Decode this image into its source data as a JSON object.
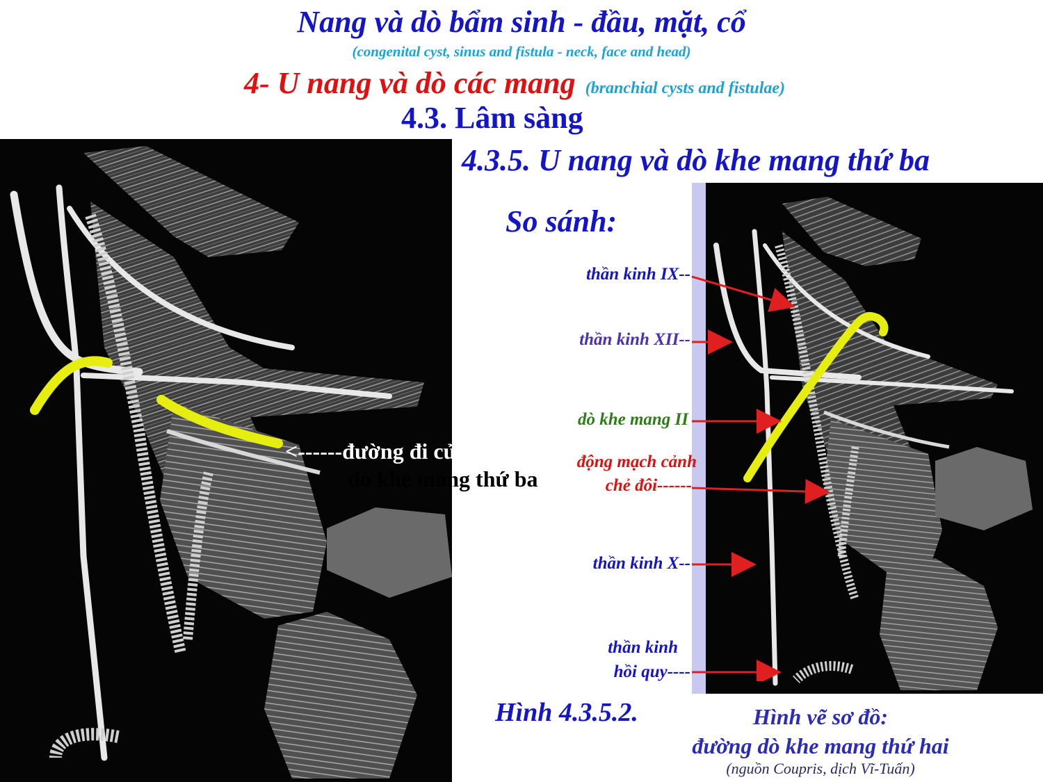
{
  "header": {
    "title": "Nang và dò bẩm sinh - đầu, mặt, cổ",
    "subtitle": "(congenital cyst, sinus and fistula - neck, face and head)",
    "section": "4- U nang và dò các mang",
    "section_en": "(branchial cysts and fistulae)",
    "subsection": "4.3. Lâm sàng",
    "subsubsection": "4.3.5. U nang và dò khe mang thứ ba"
  },
  "compare_label": "So sánh:",
  "left_figure": {
    "path_label_line1": "<------đường đi của",
    "path_label_line2": "dò khe mang thứ ba"
  },
  "labels": [
    {
      "text": "thần kinh IX--",
      "color": "#1414c8"
    },
    {
      "text": "thần kinh XII--",
      "color": "#4b2fb8"
    },
    {
      "text": "dò khe mang II",
      "color": "#2e7d1a"
    },
    {
      "text": "động mạch cảnh",
      "color": "#e01010"
    },
    {
      "text": "chẻ đôi------",
      "color": "#e01010"
    },
    {
      "text": "thần kinh X--",
      "color": "#1414c8"
    },
    {
      "text": "thần kinh",
      "color": "#1414c8"
    },
    {
      "text": "hồi quy----",
      "color": "#1414c8"
    }
  ],
  "figure_number": "Hình 4.3.5.2.",
  "caption": {
    "line1": "Hình vẽ sơ đồ:",
    "line2": "đường dò khe mang thứ hai",
    "source": "(nguồn Coupris, dịch Vĩ-Tuấn)"
  },
  "colors": {
    "fistula": "#e6ee10",
    "arrow": "#e02020",
    "panel_bg": "#050505",
    "strip": "#c8c8f0"
  }
}
